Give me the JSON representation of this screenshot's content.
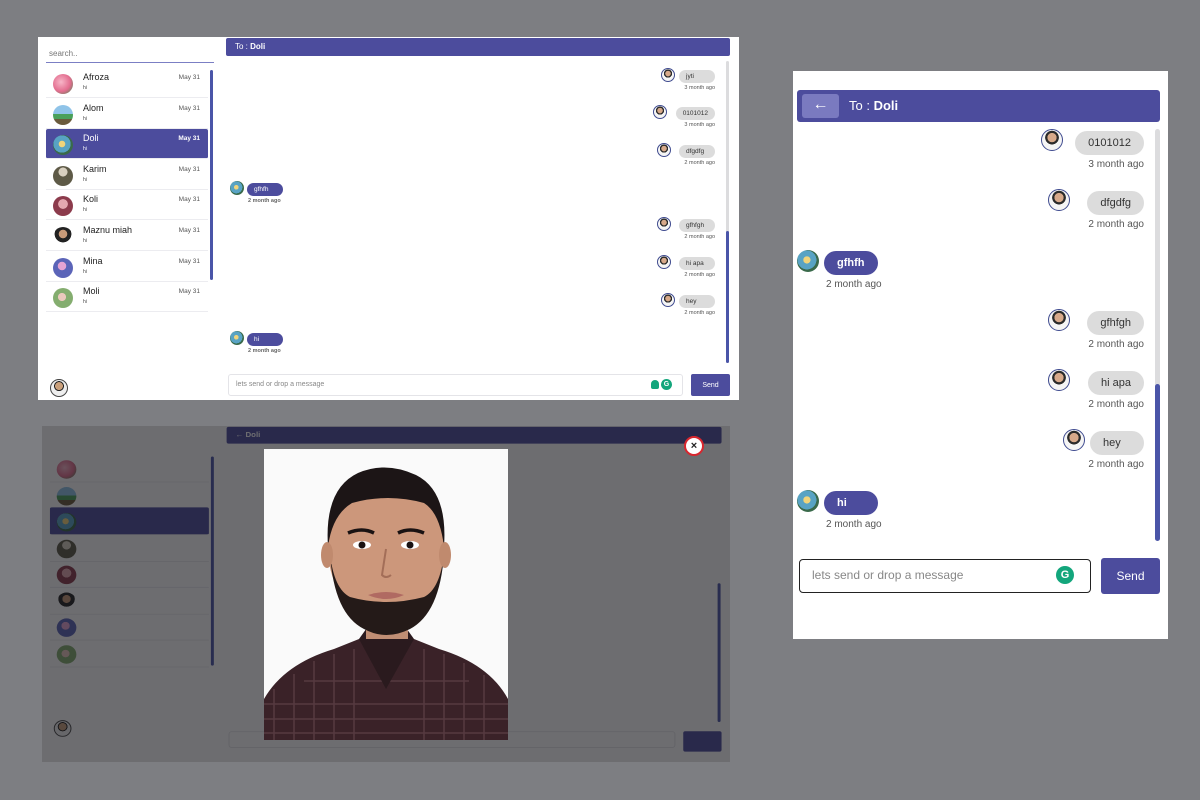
{
  "desktop": {
    "search_placeholder": "search..",
    "header": {
      "to_label": "To :",
      "name": "Doli"
    },
    "contacts": [
      {
        "name": "Afroza",
        "preview": "hi",
        "date": "May 31",
        "avatar": "a1"
      },
      {
        "name": "Alom",
        "preview": "hi",
        "date": "May 31",
        "avatar": "a2"
      },
      {
        "name": "Doli",
        "preview": "hi",
        "date": "May 31",
        "avatar": "a3",
        "active": true
      },
      {
        "name": "Karim",
        "preview": "hi",
        "date": "May 31",
        "avatar": "a4"
      },
      {
        "name": "Koli",
        "preview": "hi",
        "date": "May 31",
        "avatar": "a5"
      },
      {
        "name": "Maznu miah",
        "preview": "hi",
        "date": "May 31",
        "avatar": "a6"
      },
      {
        "name": "Mina",
        "preview": "hi",
        "date": "May 31",
        "avatar": "a7"
      },
      {
        "name": "Moli",
        "preview": "hi",
        "date": "May 31",
        "avatar": "a8"
      }
    ],
    "messages": [
      {
        "dir": "out",
        "text": "jyti",
        "time": "3 month ago"
      },
      {
        "dir": "out",
        "text": "0101012",
        "time": "3 month ago"
      },
      {
        "dir": "out",
        "text": "dfgdfg",
        "time": "2 month ago"
      },
      {
        "dir": "in",
        "text": "gfhfh",
        "time": "2 month ago"
      },
      {
        "dir": "out",
        "text": "gfhfgh",
        "time": "2 month ago"
      },
      {
        "dir": "out",
        "text": "hi apa",
        "time": "2 month ago"
      },
      {
        "dir": "out",
        "text": "hey",
        "time": "2 month ago"
      },
      {
        "dir": "in",
        "text": "hi",
        "time": "2 month ago"
      }
    ],
    "compose_placeholder": "lets send or drop a message",
    "send_label": "Send"
  },
  "modal": {
    "close_label": "×"
  },
  "mobile": {
    "back_label": "←",
    "header": {
      "to_label": "To :",
      "name": "Doli"
    },
    "messages": [
      {
        "dir": "out",
        "text": "0101012",
        "time": "3 month ago"
      },
      {
        "dir": "out",
        "text": "dfgdfg",
        "time": "2 month ago"
      },
      {
        "dir": "in",
        "text": "gfhfh",
        "time": "2 month ago"
      },
      {
        "dir": "out",
        "text": "gfhfgh",
        "time": "2 month ago"
      },
      {
        "dir": "out",
        "text": "hi apa",
        "time": "2 month ago"
      },
      {
        "dir": "out",
        "text": "hey",
        "time": "2 month ago"
      },
      {
        "dir": "in",
        "text": "hi",
        "time": "2 month ago"
      }
    ],
    "compose_placeholder": "lets send or drop a message",
    "send_label": "Send"
  },
  "colors": {
    "accent": "#4c4c9d",
    "grammarly": "#13a67c",
    "close_ring": "#d8262e"
  }
}
